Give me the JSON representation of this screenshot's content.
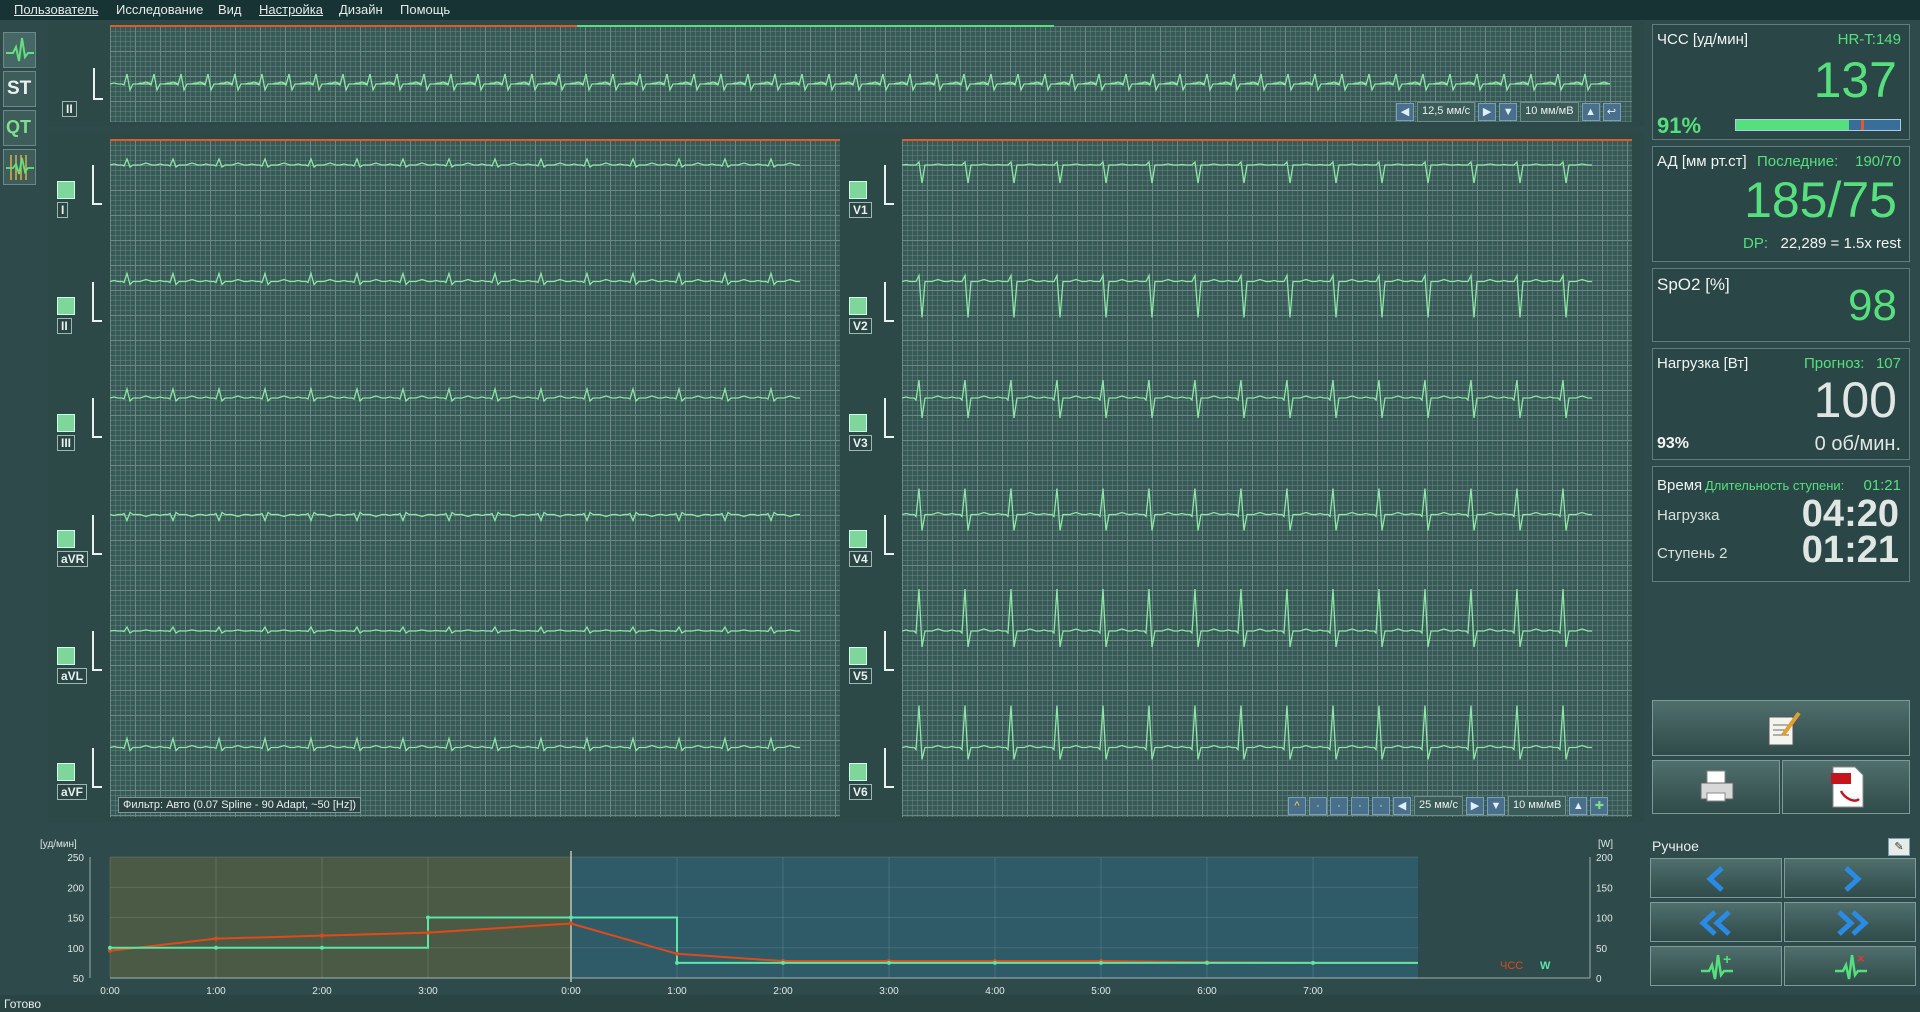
{
  "menu": [
    "Пользователь",
    "Исследование",
    "Вид",
    "Настройка",
    "Дизайн",
    "Помощь"
  ],
  "toolbar": {
    "st_label": "ST",
    "qt_label": "QT"
  },
  "rhythm": {
    "lead": "II",
    "speed": "12,5 мм/с",
    "gain": "10 мм/мВ"
  },
  "leads_left": [
    "I",
    "II",
    "III",
    "aVR",
    "aVL",
    "aVF"
  ],
  "leads_right": [
    "V1",
    "V2",
    "V3",
    "V4",
    "V5",
    "V6"
  ],
  "main_ctrl": {
    "speed": "25 мм/с",
    "gain": "10 мм/мВ"
  },
  "filter": "Фильтр: Авто (0.07 Spline - 90 Adapt, ~50 [Hz])",
  "vitals": {
    "hr": {
      "label": "ЧСС [уд/мин]",
      "target": "HR-T:149",
      "value": "137",
      "percent": "91%",
      "bar_fraction": 0.69
    },
    "bp": {
      "label": "АД [мм рт.ст]",
      "last_label": "Последние:",
      "last_value": "190/70",
      "value": "185/75",
      "dp_label": "DP:",
      "dp_value": "22,289 = 1.5x rest"
    },
    "spo2": {
      "label": "SpO2 [%]",
      "value": "98"
    },
    "load": {
      "label": "Нагрузка [Вт]",
      "forecast_label": "Прогноз:",
      "forecast_value": "107",
      "value": "100",
      "percent": "93%",
      "rpm": "0 об/мин."
    },
    "time": {
      "label": "Время",
      "stage_dur_label": "Длительность ступени:",
      "stage_dur_value": "01:21",
      "load_label": "Нагрузка",
      "load_time": "04:20",
      "stage_label": "Ступень 2",
      "stage_time": "01:21"
    }
  },
  "manual": {
    "label": "Ручное"
  },
  "trend": {
    "left_unit": "[уд/мин]",
    "right_unit": "[W]",
    "left_ticks": [
      "250",
      "200",
      "150",
      "100",
      "50"
    ],
    "right_ticks": [
      "200",
      "150",
      "100",
      "50",
      "0"
    ],
    "x_ticks": [
      "0:00",
      "1:00",
      "2:00",
      "3:00",
      "0:00",
      "1:00",
      "2:00",
      "3:00",
      "4:00",
      "5:00",
      "6:00",
      "7:00"
    ],
    "legend_hr": "ЧСС",
    "legend_w": "W"
  },
  "chart_data": {
    "type": "line",
    "x": [
      "0:00",
      "1:00",
      "2:00",
      "3:00",
      "0:00",
      "1:00",
      "2:00",
      "3:00",
      "4:00",
      "5:00",
      "6:00",
      "7:00"
    ],
    "ylim": [
      50,
      250
    ],
    "y2lim": [
      0,
      200
    ],
    "series": [
      {
        "name": "ЧСС",
        "values": [
          95,
          115,
          120,
          125,
          140,
          90,
          78,
          78,
          78,
          78,
          76,
          75
        ]
      },
      {
        "name": "W",
        "values": [
          50,
          50,
          50,
          100,
          100,
          25,
          25,
          25,
          25,
          25,
          25,
          25
        ]
      }
    ],
    "colors": {
      "hr": "#e04a1a",
      "w": "#5be6a6"
    }
  },
  "status": "Готово"
}
